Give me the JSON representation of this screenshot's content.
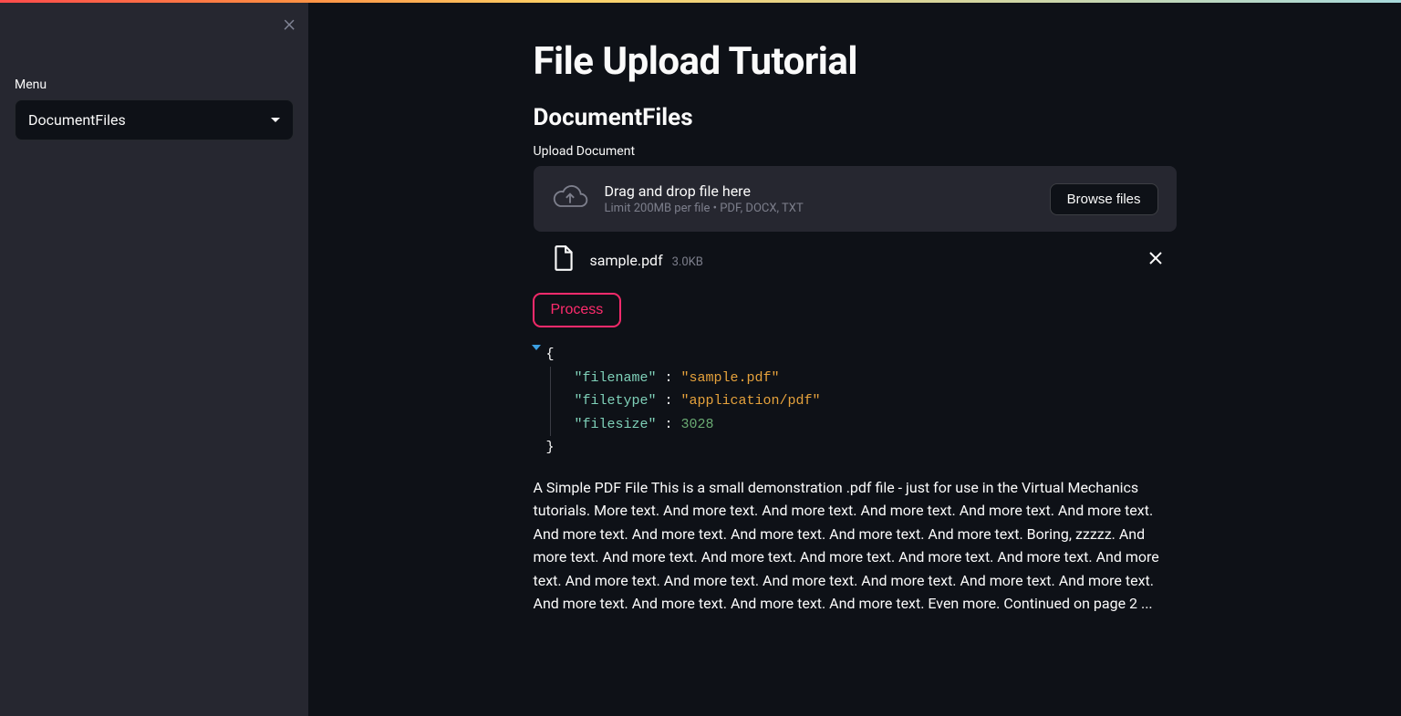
{
  "sidebar": {
    "menu_label": "Menu",
    "selected": "DocumentFiles"
  },
  "page": {
    "title": "File Upload Tutorial",
    "section": "DocumentFiles",
    "upload_label": "Upload Document",
    "dropzone_title": "Drag and drop file here",
    "dropzone_sub": "Limit 200MB per file • PDF, DOCX, TXT",
    "browse_label": "Browse files",
    "process_label": "Process"
  },
  "file": {
    "name": "sample.pdf",
    "size": "3.0KB"
  },
  "json": {
    "open": "{",
    "close": "}",
    "k_filename": "\"filename\"",
    "v_filename": "\"sample.pdf\"",
    "k_filetype": "\"filetype\"",
    "v_filetype": "\"application/pdf\"",
    "k_filesize": "\"filesize\"",
    "v_filesize": "3028",
    "colon": " : "
  },
  "body_text": "A Simple PDF File This is a small demonstration .pdf file - just for use in the Virtual Mechanics tutorials. More text. And more text. And more text. And more text. And more text. And more text. And more text. And more text. And more text. And more text. And more text. Boring, zzzzz. And more text. And more text. And more text. And more text. And more text. And more text. And more text. And more text. And more text. And more text. And more text. And more text. And more text. And more text. And more text. And more text. And more text. Even more. Continued on page 2 ..."
}
